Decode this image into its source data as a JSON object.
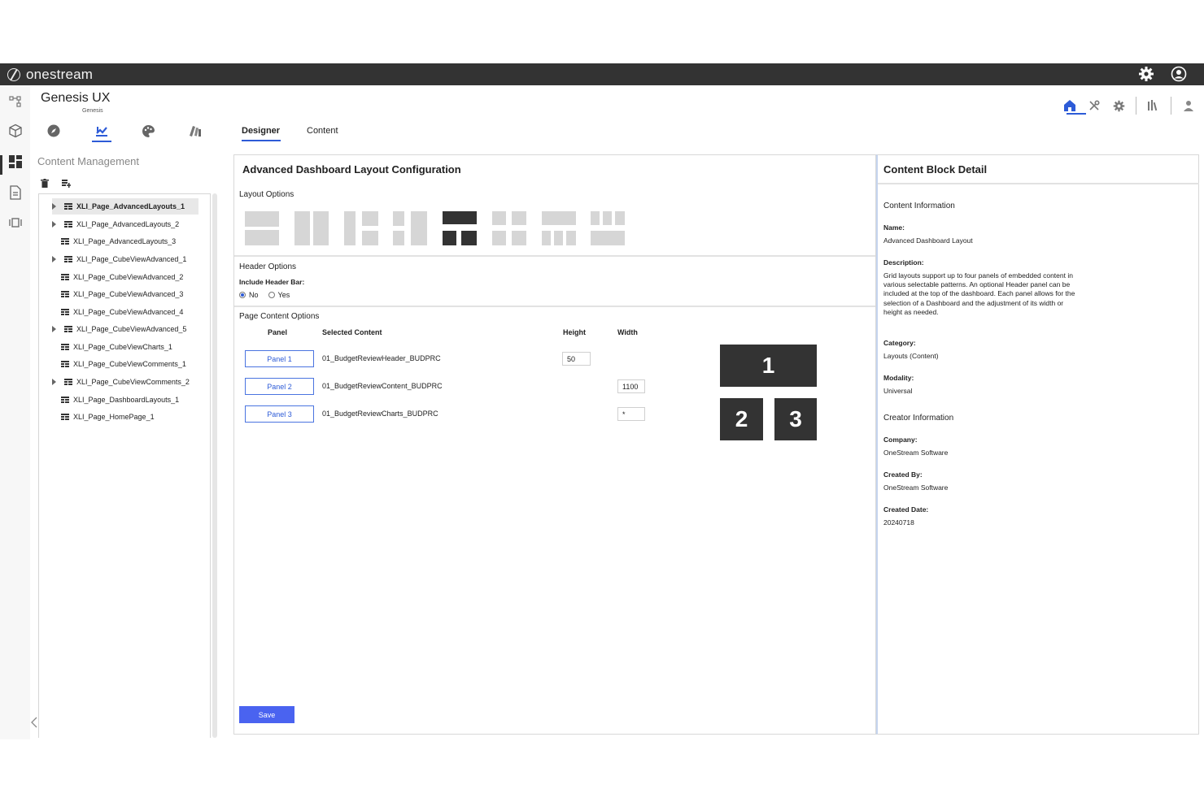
{
  "topbar": {
    "brand": "onestream"
  },
  "app": {
    "title": "Genesis UX",
    "subtitle": "Genesis"
  },
  "tabs": [
    {
      "label": "Designer",
      "active": true
    },
    {
      "label": "Content",
      "active": false
    }
  ],
  "sidebar": {
    "title": "Content Management",
    "items": [
      {
        "label": "XLI_Page_AdvancedLayouts_1",
        "expandable": true,
        "selected": true
      },
      {
        "label": "XLI_Page_AdvancedLayouts_2",
        "expandable": true,
        "selected": false
      },
      {
        "label": "XLI_Page_AdvancedLayouts_3",
        "expandable": false,
        "selected": false
      },
      {
        "label": "XLI_Page_CubeViewAdvanced_1",
        "expandable": true,
        "selected": false
      },
      {
        "label": "XLI_Page_CubeViewAdvanced_2",
        "expandable": false,
        "selected": false
      },
      {
        "label": "XLI_Page_CubeViewAdvanced_3",
        "expandable": false,
        "selected": false
      },
      {
        "label": "XLI_Page_CubeViewAdvanced_4",
        "expandable": false,
        "selected": false
      },
      {
        "label": "XLI_Page_CubeViewAdvanced_5",
        "expandable": true,
        "selected": false
      },
      {
        "label": "XLI_Page_CubeViewCharts_1",
        "expandable": false,
        "selected": false
      },
      {
        "label": "XLI_Page_CubeViewComments_1",
        "expandable": false,
        "selected": false
      },
      {
        "label": "XLI_Page_CubeViewComments_2",
        "expandable": true,
        "selected": false
      },
      {
        "label": "XLI_Page_DashboardLayouts_1",
        "expandable": false,
        "selected": false
      },
      {
        "label": "XLI_Page_HomePage_1",
        "expandable": false,
        "selected": false
      }
    ]
  },
  "main": {
    "title": "Advanced Dashboard Layout Configuration",
    "layout_options_label": "Layout Options",
    "header_options_label": "Header Options",
    "include_header_label": "Include Header Bar:",
    "radio_no": "No",
    "radio_yes": "Yes",
    "page_content_label": "Page Content Options",
    "columns": {
      "panel": "Panel",
      "selected": "Selected Content",
      "height": "Height",
      "width": "Width"
    },
    "rows": [
      {
        "panel": "Panel 1",
        "content": "01_BudgetReviewHeader_BUDPRC",
        "height": "50",
        "width": ""
      },
      {
        "panel": "Panel 2",
        "content": "01_BudgetReviewContent_BUDPRC",
        "height": "",
        "width": "1100"
      },
      {
        "panel": "Panel 3",
        "content": "01_BudgetReviewCharts_BUDPRC",
        "height": "",
        "width": "*"
      }
    ],
    "preview": {
      "box1": "1",
      "box2": "2",
      "box3": "3"
    },
    "save_label": "Save"
  },
  "detail": {
    "title": "Content Block Detail",
    "content_info": "Content Information",
    "name_label": "Name:",
    "name_value": "Advanced Dashboard Layout",
    "desc_label": "Description:",
    "desc_value": "Grid layouts support up to four panels of embedded content in various selectable patterns. An optional Header panel can be included at the top of the dashboard. Each panel allows for the selection of a Dashboard and the adjustment of its width or height as needed.",
    "category_label": "Category:",
    "category_value": "Layouts (Content)",
    "modality_label": "Modality:",
    "modality_value": "Universal",
    "creator_info": "Creator Information",
    "company_label": "Company:",
    "company_value": "OneStream Software",
    "created_by_label": "Created By:",
    "created_by_value": "OneStream Software",
    "created_date_label": "Created Date:",
    "created_date_value": "20240718"
  },
  "colors": {
    "accent": "#2d5bd7",
    "topbar": "#333333",
    "save": "#4a63f0",
    "layout_active": "#333333",
    "layout_inactive": "#d6d6d6"
  }
}
